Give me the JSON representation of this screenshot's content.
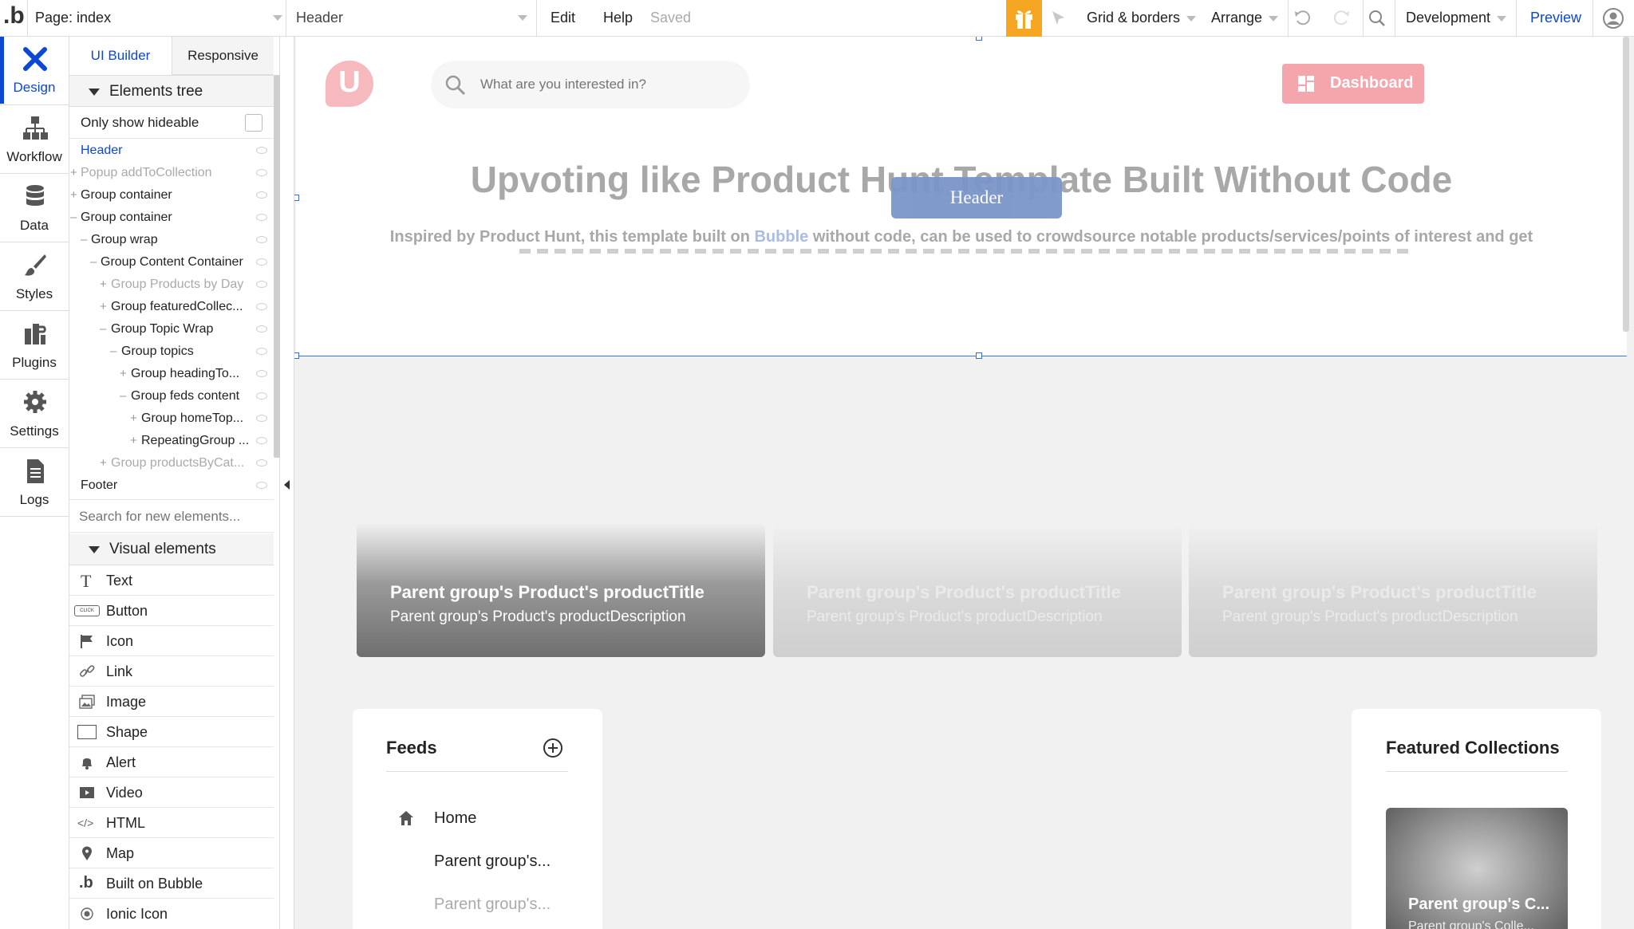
{
  "topbar": {
    "logo_glyph": ".b",
    "page_label": "Page: index",
    "element_select": "Header",
    "menu_edit": "Edit",
    "menu_help": "Help",
    "save_status": "Saved",
    "grid_borders": "Grid & borders",
    "arrange": "Arrange",
    "environment": "Development",
    "preview": "Preview"
  },
  "rail": {
    "items": [
      {
        "label": "Design",
        "icon": "design-icon"
      },
      {
        "label": "Workflow",
        "icon": "workflow-icon"
      },
      {
        "label": "Data",
        "icon": "data-icon"
      },
      {
        "label": "Styles",
        "icon": "styles-icon"
      },
      {
        "label": "Plugins",
        "icon": "plugins-icon"
      },
      {
        "label": "Settings",
        "icon": "settings-icon"
      },
      {
        "label": "Logs",
        "icon": "logs-icon"
      }
    ]
  },
  "panel": {
    "tabs": [
      "UI Builder",
      "Responsive"
    ],
    "elements_tree_title": "Elements tree",
    "only_show_hideable": "Only show hideable",
    "tree": [
      {
        "label": "Header"
      },
      {
        "label": "Popup addToCollection"
      },
      {
        "label": "Group container"
      },
      {
        "label": "Group container"
      },
      {
        "label": "Group wrap"
      },
      {
        "label": "Group Content Container"
      },
      {
        "label": "Group Products by Day"
      },
      {
        "label": "Group featuredCollec..."
      },
      {
        "label": "Group Topic Wrap"
      },
      {
        "label": "Group topics"
      },
      {
        "label": "Group headingTo..."
      },
      {
        "label": "Group feds content"
      },
      {
        "label": "Group homeTop..."
      },
      {
        "label": "RepeatingGroup ..."
      },
      {
        "label": "Group productsByCat..."
      },
      {
        "label": "Footer"
      }
    ],
    "search_placeholder": "Search for new elements...",
    "visual_elements_title": "Visual elements",
    "visual_elements": [
      {
        "label": "Text",
        "icon": "text-icon"
      },
      {
        "label": "Button",
        "icon": "button-icon",
        "icon_text": "CLICK"
      },
      {
        "label": "Icon",
        "icon": "flag-icon"
      },
      {
        "label": "Link",
        "icon": "link-icon"
      },
      {
        "label": "Image",
        "icon": "image-icon"
      },
      {
        "label": "Shape",
        "icon": "shape-icon"
      },
      {
        "label": "Alert",
        "icon": "bell-icon"
      },
      {
        "label": "Video",
        "icon": "video-icon"
      },
      {
        "label": "HTML",
        "icon": "code-icon",
        "icon_text": "</>"
      },
      {
        "label": "Map",
        "icon": "map-pin-icon"
      },
      {
        "label": "Built on Bubble",
        "icon": "bubble-icon",
        "icon_text": ".b"
      },
      {
        "label": "Ionic Icon",
        "icon": "ionic-icon"
      }
    ]
  },
  "canvas": {
    "logo_letter": "U",
    "search_placeholder": "What are you interested in?",
    "dashboard_button": "Dashboard",
    "hero_title": "Upvoting like Product Hunt Template Built Without Code",
    "hero_sub_before": "Inspired by Product Hunt, this template built on ",
    "hero_sub_link": "Bubble",
    "hero_sub_after": " without code, can be used to crowdsource notable products/services/points of interest and get",
    "header_tag": "Header",
    "card_title": "Parent group's Product's productTitle",
    "card_desc": "Parent group's Product's productDescription",
    "feeds_title": "Feeds",
    "feeds_home": "Home",
    "feeds_item_1": "Parent group's...",
    "feeds_item_2": "Parent group's...",
    "featured_title": "Featured Collections",
    "featured_card_title": "Parent group's C...",
    "featured_card_sub": "Parent group's Colle..."
  },
  "colors": {
    "accent": "#0d47d6",
    "gift": "#f5a623",
    "dashboard": "#f4a6ac",
    "logo_bg": "#f6b9be",
    "header_tag": "#7a96c9"
  }
}
